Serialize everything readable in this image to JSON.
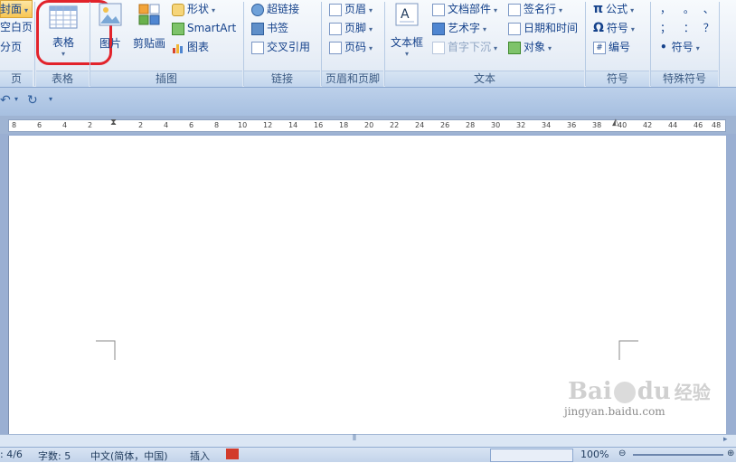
{
  "ribbon": {
    "pages_group": {
      "label": "页",
      "items": [
        "封面",
        "空白页",
        "分页"
      ]
    },
    "table_group": {
      "label": "表格",
      "table_button": "表格"
    },
    "illustrations_group": {
      "label": "插图",
      "picture": "图片",
      "clipart": "剪贴画",
      "shapes": "形状",
      "smartart": "SmartArt",
      "chart": "图表"
    },
    "links_group": {
      "label": "链接",
      "hyperlink": "超链接",
      "bookmark": "书签",
      "crossref": "交叉引用"
    },
    "header_footer_group": {
      "label": "页眉和页脚",
      "header": "页眉",
      "footer": "页脚",
      "page_number": "页码"
    },
    "text_group": {
      "label": "文本",
      "textbox": "文本框",
      "quickparts": "文档部件",
      "wordart": "艺术字",
      "dropcap": "首字下沉",
      "signature": "签名行",
      "datetime": "日期和时间",
      "object": "对象"
    },
    "symbols_group": {
      "label": "符号",
      "equation": "公式",
      "symbol": "符号",
      "number": "编号"
    },
    "special_group": {
      "label": "特殊符号",
      "chars": [
        "，",
        "。",
        "、",
        "；",
        "：",
        "？"
      ],
      "symbol": "符号"
    }
  },
  "ruler": {
    "ticks_left": [
      "8",
      "6",
      "4",
      "2"
    ],
    "ticks_right": [
      "2",
      "4",
      "6",
      "8",
      "10",
      "12",
      "14",
      "16",
      "18",
      "20",
      "22",
      "24",
      "26",
      "28",
      "30",
      "32",
      "34",
      "36",
      "38",
      "40",
      "42",
      "44",
      "46",
      "48"
    ]
  },
  "status": {
    "page": ": 4/6",
    "words": "字数: 5",
    "language": "中文(简体，中国)",
    "mode": "插入",
    "zoom": "100%"
  },
  "watermark": {
    "brand": "Bai",
    "brand2": "du",
    "suffix": "经验",
    "url": "jingyan.baidu.com"
  },
  "colors": {
    "highlight": "#e2232b",
    "ribbon": "#e9eff7",
    "doc_bg": "#9aafd2"
  }
}
